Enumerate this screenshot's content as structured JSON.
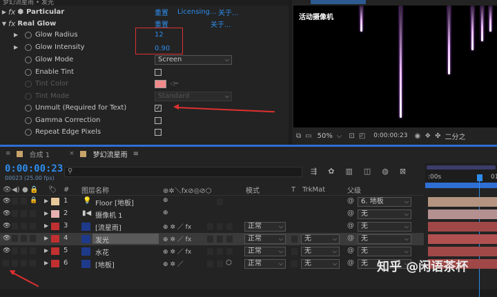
{
  "effects": {
    "breadcrumb": "梦幻流星雨 • 发光",
    "plugins": [
      {
        "name": "Particular",
        "reset": "重置",
        "licensing": "Licensing...",
        "about": "关于..."
      },
      {
        "name": "Real Glow",
        "reset": "重置",
        "about": "关于..."
      }
    ],
    "props": [
      {
        "name": "Glow Radius",
        "value": "12"
      },
      {
        "name": "Glow Intensity",
        "value": "0.90"
      },
      {
        "name": "Glow Mode",
        "select": "Screen"
      },
      {
        "name": "Enable Tint",
        "checked": false
      },
      {
        "name": "Tint Color",
        "color": "#f08a8a"
      },
      {
        "name": "Tint Mode",
        "select": "Standard"
      },
      {
        "name": "Unmult (Required for Text)",
        "checked": true
      },
      {
        "name": "Gamma Correction",
        "checked": false
      },
      {
        "name": "Repeat Edge Pixels",
        "checked": false
      }
    ]
  },
  "viewer": {
    "tab": "梦幻流星雨",
    "camera_label": "活动摄像机",
    "zoom": "50%",
    "timecode": "0:00:00:23",
    "channel": "二分之"
  },
  "timeline": {
    "tabs": [
      {
        "label": "合成 1",
        "color": "#c8a46a"
      },
      {
        "label": "梦幻流星雨",
        "color": "#c8a46a"
      }
    ],
    "timecode": "0:00:00:23",
    "timecode_sub": "00023 (25.00 fps)",
    "ruler_start": ":00s",
    "ruler_end": "01",
    "headers": {
      "num": "#",
      "name": "图层名称",
      "mode": "模式",
      "t": "T",
      "trkmat": "TrkMat",
      "parent": "父级"
    },
    "layers": [
      {
        "num": "1",
        "name": "Floor [地板]",
        "label_color": "#e8c89a",
        "src": "light",
        "mode": "",
        "trkmat": "",
        "parent": "6. 地板",
        "bar_color": "#b49480",
        "visible": true,
        "locked": true
      },
      {
        "num": "2",
        "name": "摄像机 1",
        "label_color": "#e8b0b0",
        "src": "camera",
        "mode": "",
        "trkmat": "",
        "parent": "无",
        "bar_color": "#b49090",
        "visible": true,
        "locked": false
      },
      {
        "num": "3",
        "name": "[流星雨]",
        "label_color": "#c03030",
        "src": "#1e3a8a",
        "mode": "正常",
        "trkmat": "",
        "parent": "无",
        "bar_color": "#a04848",
        "visible": true,
        "locked": false
      },
      {
        "num": "4",
        "name": "发光",
        "label_color": "#c03030",
        "src": "#1e3a8a",
        "mode": "正常",
        "trkmat": "无",
        "parent": "无",
        "bar_color": "#b05050",
        "visible": true,
        "locked": false,
        "selected": true
      },
      {
        "num": "5",
        "name": "水花",
        "label_color": "#c03030",
        "src": "#1e3a8a",
        "mode": "正常",
        "trkmat": "无",
        "parent": "无",
        "bar_color": "#a04848",
        "visible": true,
        "locked": false
      },
      {
        "num": "6",
        "name": "[地板]",
        "label_color": "#c03030",
        "src": "#1e3a8a",
        "mode": "正常",
        "trkmat": "无",
        "parent": "无",
        "bar_color": "#a04848",
        "visible": false,
        "locked": false
      }
    ]
  },
  "watermark": "知乎 @闲语茶杯"
}
